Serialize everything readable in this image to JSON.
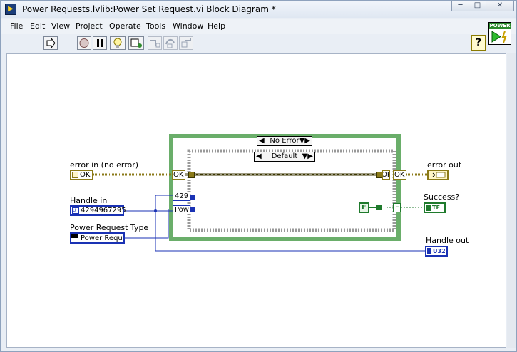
{
  "window": {
    "title": "Power Requests.lvlib:Power Set Request.vi Block Diagram *"
  },
  "menubar": {
    "items": [
      "File",
      "Edit",
      "View",
      "Project",
      "Operate",
      "Tools",
      "Window",
      "Help"
    ]
  },
  "toolbar": {
    "help_label": "?",
    "connector_label": "POWER"
  },
  "diagram": {
    "error_in": {
      "label": "error in (no error)",
      "value": "OK"
    },
    "handle_in": {
      "label": "Handle in",
      "value": "4294967295"
    },
    "power_request_type": {
      "label": "Power Request Type",
      "value": "Power Requ"
    },
    "error_out": {
      "label": "error out"
    },
    "success": {
      "label": "Success?",
      "terminal_text": "TF"
    },
    "handle_out": {
      "label": "Handle out",
      "terminal_text": "U32"
    },
    "outer_case": {
      "selector": "No Error"
    },
    "inner_case": {
      "selector": "Default"
    },
    "tunnels": {
      "err_left": "OK",
      "handle_left": "429",
      "power_left": "Pow",
      "err_inner_right": "OK",
      "err_outer_right": "OK",
      "success_outer_right": "F"
    },
    "false_constant": "F"
  },
  "colors": {
    "error_wire": "#8b7a18",
    "error_wire_dark": "#3b3600",
    "numeric_wire": "#1a32b4",
    "boolean_wire": "#1f7a2c",
    "case_border": "#6aae6a"
  }
}
